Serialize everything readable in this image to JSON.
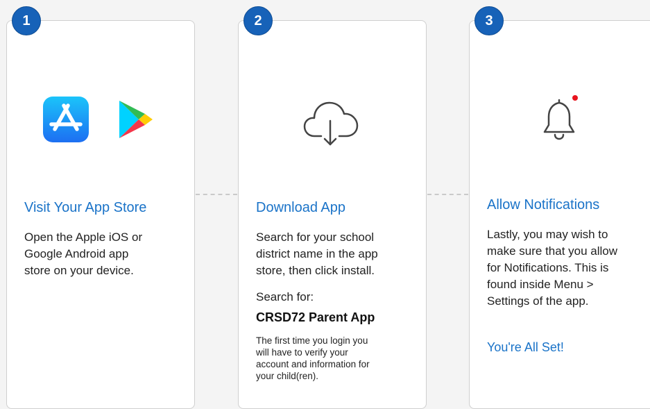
{
  "steps": [
    {
      "number": "1",
      "title": "Visit Your App Store",
      "body_lines": [
        "Open the Apple iOS or",
        "Google Android app",
        "store on your device."
      ],
      "icons": [
        "app-store-icon",
        "google-play-icon"
      ]
    },
    {
      "number": "2",
      "title": "Download App",
      "body_lines": [
        "Search for your school",
        "district name in the app",
        "store, then click install."
      ],
      "search_label": "Search for:",
      "app_name": "CRSD72 Parent App",
      "note_lines": [
        "The first time you login you",
        "will have to verify your",
        "account and information for",
        "your child(ren)."
      ],
      "icons": [
        "cloud-download-icon"
      ]
    },
    {
      "number": "3",
      "title": "Allow Notifications",
      "body_lines": [
        "Lastly, you may wish to",
        "make sure that you allow",
        "for Notifications. This is",
        "found inside Menu >",
        "Settings of the app."
      ],
      "closing": "You're All Set!",
      "icons": [
        "bell-icon"
      ]
    }
  ],
  "colors": {
    "accent": "#1a73c8",
    "badge": "#1762b8",
    "notification_dot": "#e8141e"
  }
}
